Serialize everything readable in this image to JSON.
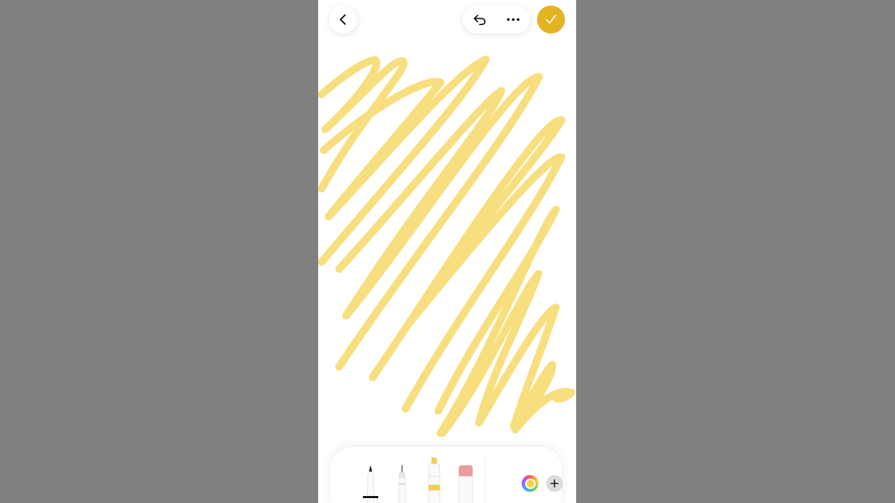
{
  "colors": {
    "ink": "#f7dc72",
    "accent": "#e3b321",
    "background": "#808080"
  },
  "icons": {
    "back": "chevron-left-icon",
    "undo": "undo-icon",
    "more": "more-horizontal-icon",
    "done": "checkmark-icon",
    "add": "plus-icon"
  },
  "toolbar": {
    "tools": [
      "pen",
      "fineliner",
      "highlighter",
      "eraser"
    ],
    "selected_tool": "highlighter",
    "current_color": "#f7d04a"
  }
}
